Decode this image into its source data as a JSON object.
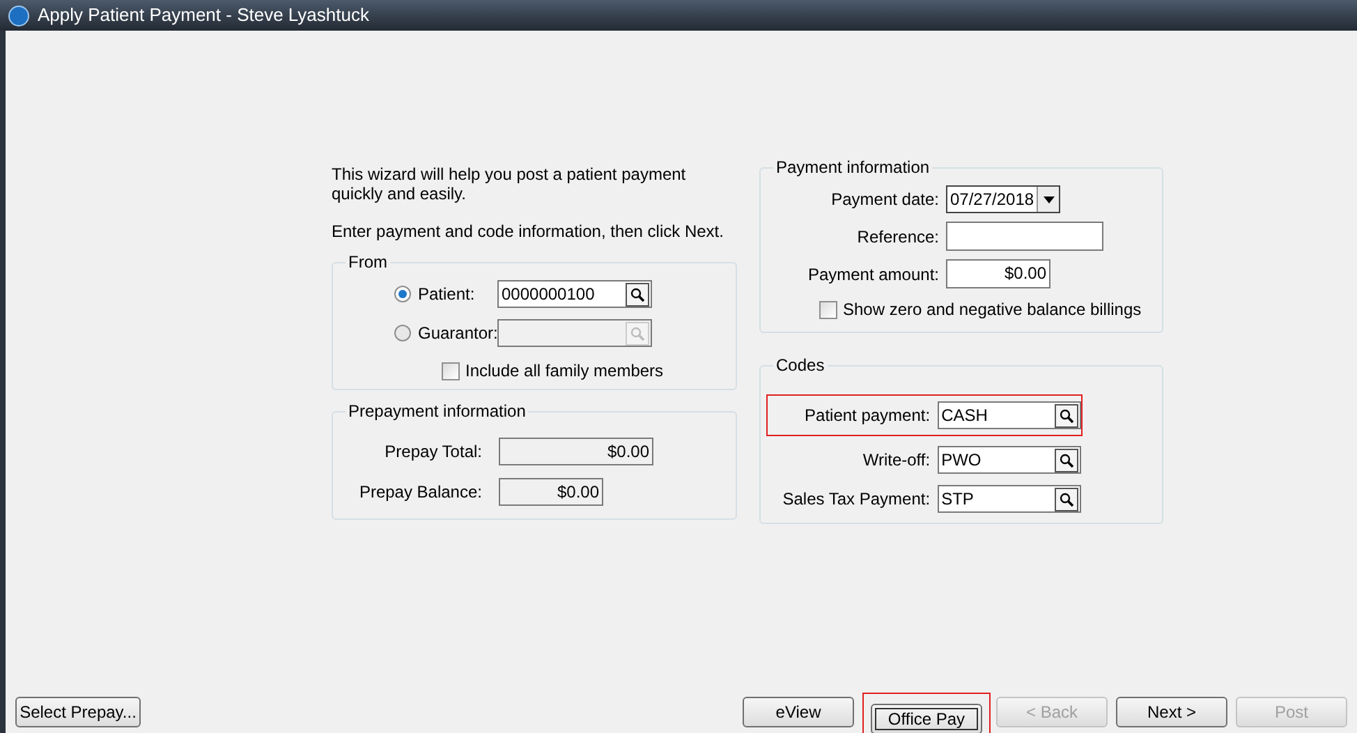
{
  "window": {
    "title": "Apply Patient Payment - Steve Lyashtuck"
  },
  "intro": [
    "This wizard will help you post a patient payment quickly and easily.",
    "Enter payment and code information, then click Next."
  ],
  "from": {
    "title": "From",
    "options": [
      {
        "label": "Patient:",
        "selected": true,
        "disabled": false,
        "value": "0000000100"
      },
      {
        "label": "Guarantor:",
        "selected": false,
        "disabled": true
      }
    ],
    "family": {
      "label": "Include all family members",
      "checked": false
    }
  },
  "prepayment": {
    "title": "Prepayment information",
    "fields": [
      {
        "label": "Prepay Total:",
        "value": "$0.00",
        "wide": true
      },
      {
        "label": "Prepay Balance:",
        "value": "$0.00",
        "wide": false
      }
    ]
  },
  "payment": {
    "title": "Payment information",
    "date": {
      "label": "Payment date:",
      "value": "07/27/2018"
    },
    "reference": {
      "label": "Reference:"
    },
    "amount": {
      "label": "Payment amount:",
      "value": "$0.00"
    },
    "show_zero": {
      "label": "Show zero and negative balance billings",
      "checked": false
    }
  },
  "codes": {
    "title": "Codes",
    "fields": [
      {
        "label": "Patient payment:",
        "value": "CASH",
        "highlighted": true
      },
      {
        "label": "Write-off:",
        "value": "PWO",
        "highlighted": false
      },
      {
        "label": "Sales Tax Payment:",
        "value": "STP",
        "highlighted": false
      }
    ]
  },
  "buttons": [
    {
      "label": "Select Prepay...",
      "kind": "left",
      "disabled": false,
      "highlighted": false,
      "default": false
    },
    {
      "label": "eView",
      "kind": "right",
      "disabled": false,
      "highlighted": false,
      "default": false
    },
    {
      "label": "Office Pay",
      "kind": "right",
      "disabled": false,
      "highlighted": true,
      "default": true
    },
    {
      "label": "< Back",
      "kind": "right",
      "disabled": true,
      "highlighted": false,
      "default": false
    },
    {
      "label": "Next >",
      "kind": "right",
      "disabled": false,
      "highlighted": false,
      "default": false
    },
    {
      "label": "Post",
      "kind": "right",
      "disabled": true,
      "highlighted": false,
      "default": false
    }
  ]
}
